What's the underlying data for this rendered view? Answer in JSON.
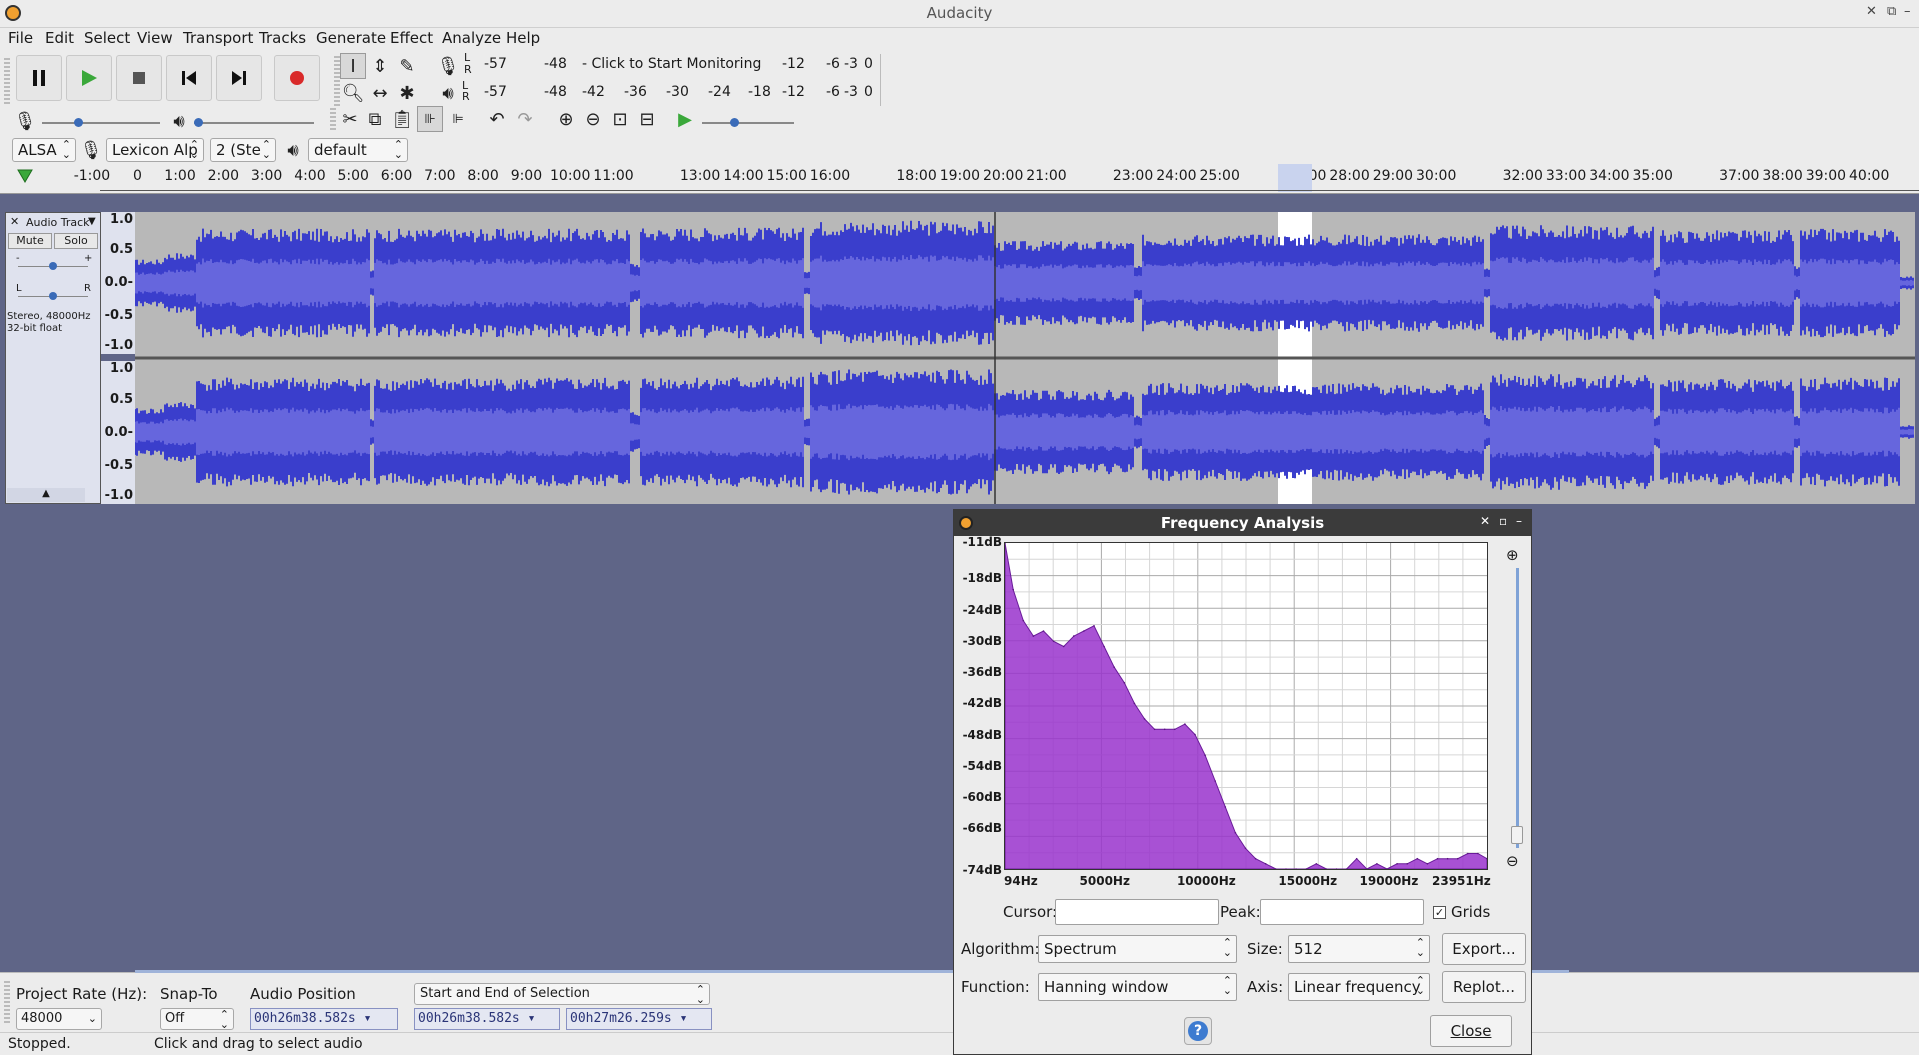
{
  "window": {
    "title": "Audacity"
  },
  "menu": [
    "File",
    "Edit",
    "Select",
    "View",
    "Transport",
    "Tracks",
    "Generate",
    "Effect",
    "Analyze",
    "Help"
  ],
  "meters": {
    "rec_label_l": "L",
    "rec_label_r": "R",
    "rec_scale": [
      "-57",
      "-48",
      "- Click to Start Monitoring",
      "-12",
      "-6",
      "-3",
      "0"
    ],
    "play_scale": [
      "-57",
      "-48",
      "-42",
      "-36",
      "-30",
      "-24",
      "-18",
      "-12",
      "-6",
      "-3",
      "0"
    ]
  },
  "device": {
    "host": "ALSA",
    "rec_device": "Lexicon Alp",
    "channels": "2 (Ste",
    "play_device": "default"
  },
  "timeline": {
    "ticks": [
      "-1:00",
      "0",
      "1:00",
      "2:00",
      "3:00",
      "4:00",
      "5:00",
      "6:00",
      "7:00",
      "8:00",
      "9:00",
      "10:00",
      "11:00",
      "13:00",
      "14:00",
      "15:00",
      "16:00",
      "18:00",
      "19:00",
      "20:00",
      "21:00",
      "23:00",
      "24:00",
      "25:00",
      "27:00",
      "28:00",
      "29:00",
      "30:00",
      "32:00",
      "33:00",
      "34:00",
      "35:00",
      "37:00",
      "38:00",
      "39:00",
      "40:00"
    ]
  },
  "track": {
    "name": "Audio Track",
    "mute": "Mute",
    "solo": "Solo",
    "gain_minus": "-",
    "gain_plus": "+",
    "pan_l": "L",
    "pan_r": "R",
    "info1": "Stereo, 48000Hz",
    "info2": "32-bit float",
    "scale": [
      "1.0",
      "0.5",
      "0.0-",
      "-0.5",
      "-1.0"
    ]
  },
  "selection_toolbar": {
    "project_rate_label": "Project Rate (Hz):",
    "project_rate": "48000",
    "snap_to_label": "Snap-To",
    "snap_to": "Off",
    "audio_position_label": "Audio Position",
    "audio_position": "00h26m38.582s",
    "selection_mode": "Start and End of Selection",
    "sel_start": "00h26m38.582s",
    "sel_end": "00h27m26.259s"
  },
  "status": {
    "state": "Stopped.",
    "hint": "Click and drag to select audio"
  },
  "dialog": {
    "title": "Frequency Analysis",
    "cursor_label": "Cursor:",
    "cursor_value": "",
    "peak_label": "Peak:",
    "peak_value": "",
    "grids_label": "Grids",
    "grids_checked": true,
    "algorithm_label": "Algorithm:",
    "algorithm": "Spectrum",
    "size_label": "Size:",
    "size": "512",
    "function_label": "Function:",
    "function": "Hanning window",
    "axis_label": "Axis:",
    "axis": "Linear frequency",
    "export_button": "Export...",
    "replot_button": "Replot...",
    "close_button": "Close",
    "help_button": "?"
  },
  "chart_data": {
    "type": "area",
    "title": "",
    "xlabel": "",
    "ylabel": "",
    "x_tick_labels": [
      "94Hz",
      "5000Hz",
      "10000Hz",
      "15000Hz",
      "19000Hz",
      "23951Hz"
    ],
    "y_tick_labels": [
      "-11dB",
      "-18dB",
      "-24dB",
      "-30dB",
      "-36dB",
      "-42dB",
      "-48dB",
      "-54dB",
      "-60dB",
      "-66dB",
      "-74dB"
    ],
    "xlim": [
      94,
      23951
    ],
    "ylim": [
      -74,
      -11
    ],
    "grid": true,
    "color": "#9933cc",
    "x": [
      94,
      500,
      1000,
      1500,
      2000,
      2500,
      3000,
      3500,
      4000,
      4500,
      5000,
      5500,
      6000,
      6500,
      7000,
      7500,
      8000,
      8500,
      9000,
      9500,
      10000,
      10500,
      11000,
      11500,
      12000,
      12500,
      13000,
      13500,
      14000,
      14500,
      15000,
      15500,
      16000,
      16500,
      17000,
      17500,
      18000,
      18500,
      19000,
      19500,
      20000,
      20500,
      21000,
      21500,
      22000,
      22500,
      23000,
      23500,
      23951
    ],
    "y": [
      -11,
      -20,
      -26,
      -29,
      -28,
      -30,
      -31,
      -29,
      -28,
      -27,
      -31,
      -35,
      -38,
      -42,
      -45,
      -47,
      -47,
      -47,
      -46,
      -48,
      -52,
      -57,
      -62,
      -67,
      -70,
      -72,
      -73,
      -74,
      -74,
      -74,
      -74,
      -73,
      -74,
      -74,
      -74,
      -72,
      -74,
      -73,
      -74,
      -73,
      -73,
      -72,
      -73,
      -72,
      -72,
      -72,
      -71,
      -71,
      -72
    ]
  }
}
